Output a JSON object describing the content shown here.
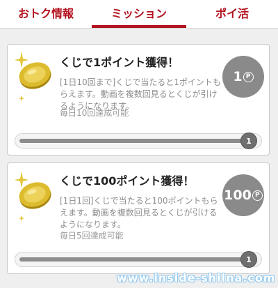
{
  "tabs": [
    {
      "label": "おトク情報"
    },
    {
      "label": "ミッション",
      "active": true
    },
    {
      "label": "ポイ活"
    }
  ],
  "missions": [
    {
      "title": "くじで1ポイント獲得！",
      "description": "[1日10回まで]くじで当たると1ポイントもらえます。動画を複数回見るとくじが引けるようになります。",
      "note": "毎日10回達成可能",
      "points": "1",
      "point_unit": "P",
      "progress_label": "1",
      "progress_fraction": 1.0
    },
    {
      "title": "くじで100ポイント獲得！",
      "description": "[1日1回]くじで当たると100ポイントもらえます。動画を複数回見るとくじが引けるようになります。",
      "note": "毎日5回達成可能",
      "points": "100",
      "point_unit": "P",
      "progress_label": "1",
      "progress_fraction": 1.0
    }
  ],
  "watermark": "www.inside-shilna.com",
  "colors": {
    "accent": "#b3121f",
    "badge": "#8a8a8a",
    "coin": "#d8b52a"
  }
}
